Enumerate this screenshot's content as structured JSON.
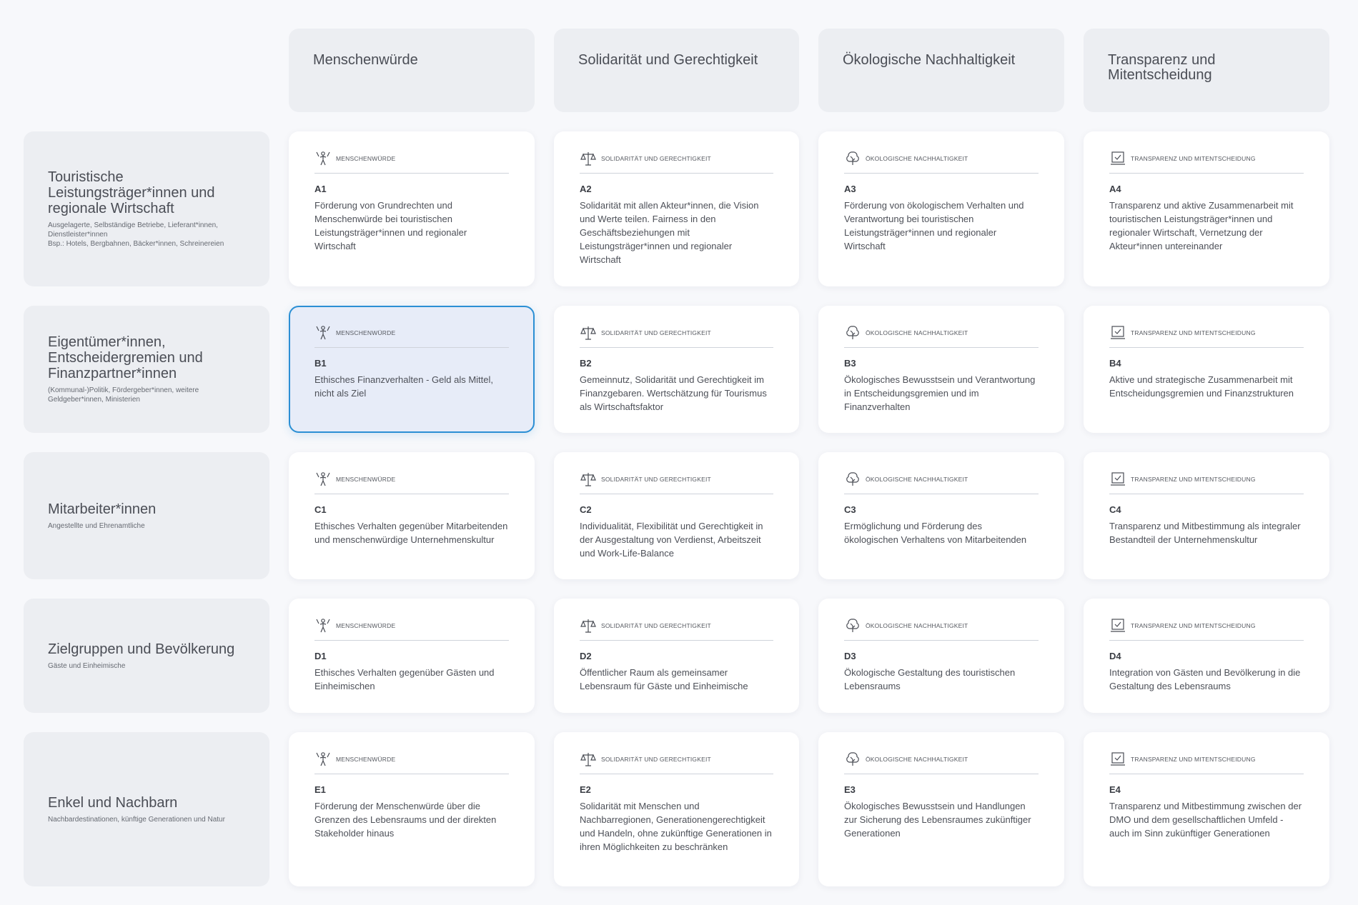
{
  "columns": [
    {
      "title": "Menschenwürde",
      "icon": "human-dignity-icon",
      "category": "MENSCHENWÜRDE"
    },
    {
      "title": "Solidarität und Gerechtigkeit",
      "icon": "scales-icon",
      "category": "SOLIDARITÄT UND GERECHTIGKEIT"
    },
    {
      "title": "Ökologische Nachhaltigkeit",
      "icon": "tree-icon",
      "category": "ÖKOLOGISCHE NACHHALTIGKEIT"
    },
    {
      "title": "Transparenz und Mitentscheidung",
      "icon": "checkbox-icon",
      "category": "TRANSPARENZ UND MITENTSCHEIDUNG"
    }
  ],
  "rows": [
    {
      "title": "Touristische Leistungsträger*innen und regionale Wirtschaft",
      "subtitle": "Ausgelagerte, Selbständige Betriebe, Lieferant*innen, Dienstleister*innen\nBsp.: Hotels, Bergbahnen, Bäcker*innen, Schreinereien",
      "cells": [
        {
          "code": "A1",
          "text": "Förderung von Grundrechten und Menschenwürde bei touristischen Leistungsträger*innen und regionaler Wirtschaft"
        },
        {
          "code": "A2",
          "text": "Solidarität mit allen Akteur*innen, die Vision und Werte teilen. Fairness in den Geschäftsbeziehungen mit Leistungsträger*innen und regionaler Wirtschaft"
        },
        {
          "code": "A3",
          "text": "Förderung von ökologischem Verhalten und Verantwortung bei touristischen Leistungsträger*innen und regionaler Wirtschaft"
        },
        {
          "code": "A4",
          "text": "Transparenz und aktive Zusammenarbeit mit touristischen Leistungsträger*innen und regionaler Wirtschaft, Vernetzung der Akteur*innen untereinander"
        }
      ]
    },
    {
      "title": "Eigentümer*innen, Entscheidergremien und Finanzpartner*innen",
      "subtitle": "(Kommunal-)Politik, Fördergeber*innen, weitere Geldgeber*innen, Ministerien",
      "cells": [
        {
          "code": "B1",
          "text": "Ethisches Finanzverhalten - Geld als Mittel, nicht als Ziel",
          "selected": true
        },
        {
          "code": "B2",
          "text": "Gemeinnutz, Solidarität und Gerechtigkeit im Finanzgebaren. Wertschätzung für Tourismus als Wirtschaftsfaktor"
        },
        {
          "code": "B3",
          "text": "Ökologisches Bewusstsein und Verantwortung in Entscheidungsgremien und im Finanzverhalten"
        },
        {
          "code": "B4",
          "text": "Aktive und strategische Zusammenarbeit mit Entscheidungsgremien und Finanzstrukturen"
        }
      ]
    },
    {
      "title": "Mitarbeiter*innen",
      "subtitle": "Angestellte und Ehrenamtliche",
      "cells": [
        {
          "code": "C1",
          "text": "Ethisches Verhalten gegenüber Mitarbeitenden und menschenwürdige Unternehmenskultur"
        },
        {
          "code": "C2",
          "text": "Individualität, Flexibilität und Gerechtigkeit in der Ausgestaltung von Verdienst, Arbeitszeit und Work-Life-Balance"
        },
        {
          "code": "C3",
          "text": "Ermöglichung und Förderung des ökologischen Verhaltens von Mitarbeitenden"
        },
        {
          "code": "C4",
          "text": "Transparenz und Mitbestimmung als integraler Bestandteil der Unternehmenskultur"
        }
      ]
    },
    {
      "title": "Zielgruppen und Bevölkerung",
      "subtitle": "Gäste und Einheimische",
      "cells": [
        {
          "code": "D1",
          "text": "Ethisches Verhalten gegenüber Gästen und Einheimischen"
        },
        {
          "code": "D2",
          "text": "Öffentlicher Raum als gemeinsamer Lebensraum für Gäste und Einheimische"
        },
        {
          "code": "D3",
          "text": "Ökologische Gestaltung des touristischen Lebensraums"
        },
        {
          "code": "D4",
          "text": "Integration von Gästen und Bevölkerung in die Gestaltung des Lebensraums"
        }
      ]
    },
    {
      "title": "Enkel und Nachbarn",
      "subtitle": "Nachbardestinationen, künftige Generationen und Natur",
      "cells": [
        {
          "code": "E1",
          "text": "Förderung der Menschenwürde über die Grenzen des Lebensraums und der direkten Stakeholder hinaus"
        },
        {
          "code": "E2",
          "text": "Solidarität mit Menschen und Nachbarregionen, Generationengerechtigkeit und Handeln, ohne zukünftige Generationen in ihren Möglichkeiten zu beschränken"
        },
        {
          "code": "E3",
          "text": "Ökologisches Bewusstsein und Handlungen zur Sicherung des Lebensraumes zukünftiger Generationen"
        },
        {
          "code": "E4",
          "text": "Transparenz und Mitbestimmung zwischen der DMO und dem gesellschaftlichen Umfeld - auch im Sinn zukünftiger Generationen"
        }
      ]
    }
  ],
  "colors": {
    "selected_border": "#2b8fd4",
    "selected_bg": "#e7ecf8",
    "panel_bg": "#eceef2"
  }
}
